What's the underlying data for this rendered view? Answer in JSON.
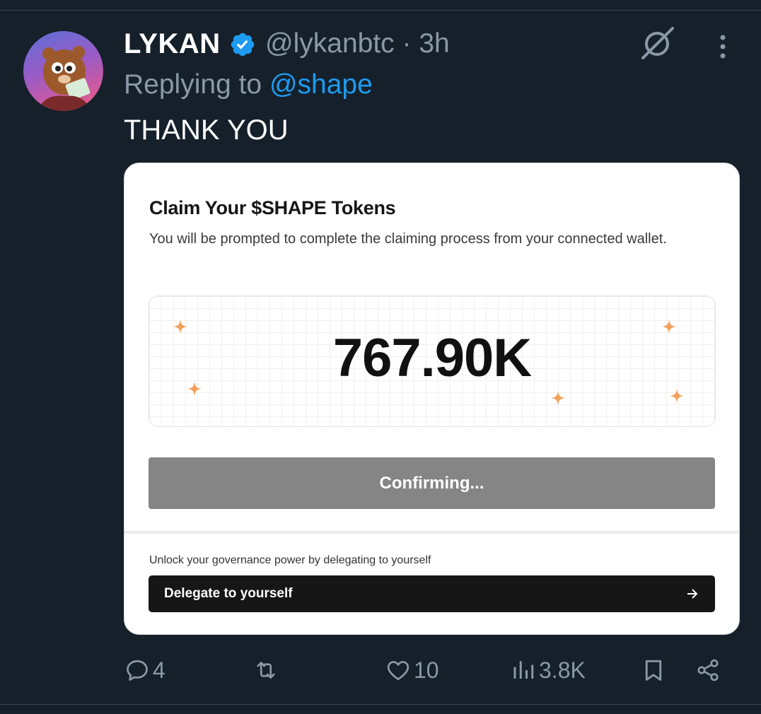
{
  "tweet": {
    "display_name": "LYKAN",
    "handle": "@lykanbtc",
    "time": "· 3h",
    "replying_prefix": "Replying to ",
    "replying_to": "@shape",
    "text": "THANK YOU"
  },
  "card": {
    "title": "Claim Your $SHAPE Tokens",
    "subtitle": "You will be prompted to complete the claiming process from your connected wallet.",
    "amount": "767.90K",
    "confirm_label": "Confirming...",
    "governance_text": "Unlock your governance power by delegating to yourself",
    "delegate_label": "Delegate to yourself"
  },
  "actions": {
    "replies": "4",
    "retweets": "",
    "likes": "10",
    "views": "3.8K"
  },
  "colors": {
    "background": "#15202b",
    "secondary_text": "#8b98a5",
    "link": "#1d9bf0",
    "sparkle": "#f3a15b",
    "confirm_button": "#858585"
  },
  "icons": [
    "verified-badge-icon",
    "grok-icon",
    "more-icon",
    "sparkle-icon",
    "arrow-right-icon",
    "reply-icon",
    "retweet-icon",
    "like-icon",
    "views-icon",
    "bookmark-icon",
    "share-icon"
  ]
}
